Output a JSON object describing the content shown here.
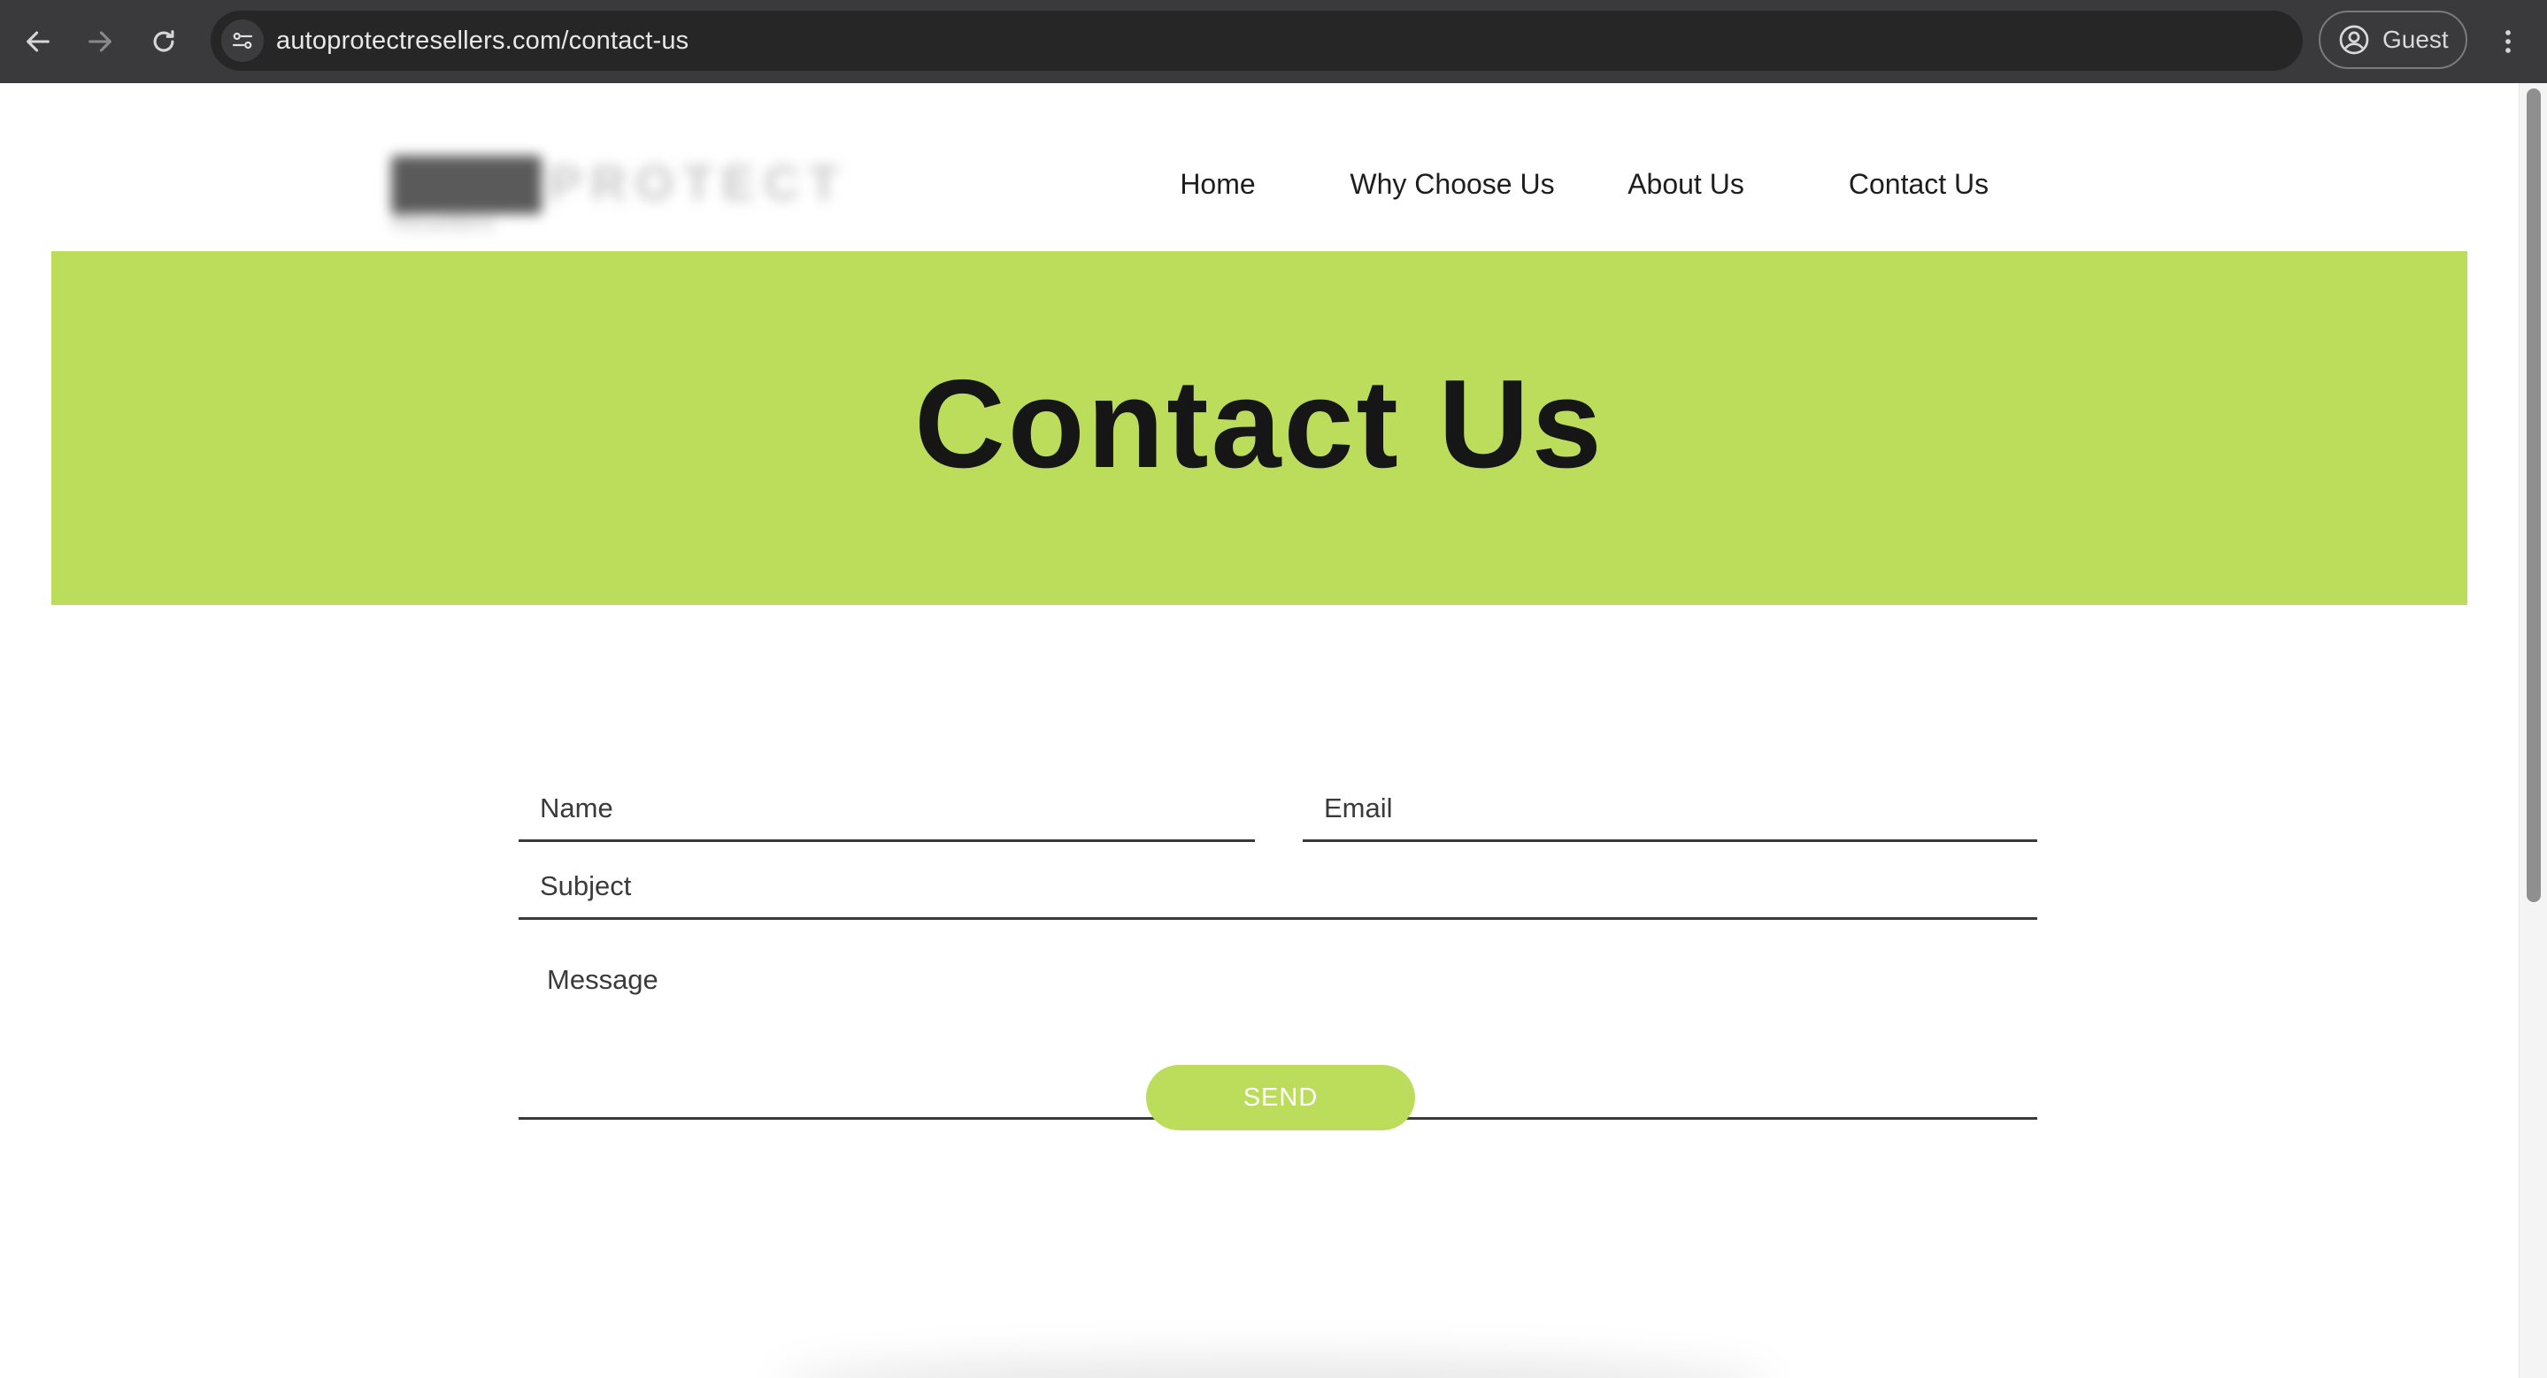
{
  "browser": {
    "url": "autoprotectresellers.com/contact-us",
    "profile_label": "Guest",
    "icons": {
      "back": "arrow-left-icon",
      "forward": "arrow-right-icon",
      "reload": "reload-icon",
      "site_info": "tune-icon",
      "profile": "person-circle-icon",
      "menu": "kebab-menu-icon"
    }
  },
  "site": {
    "logo": {
      "wordmark": "PROTECT",
      "subtitle": "Resellers"
    },
    "nav": [
      "Home",
      "Why Choose Us",
      "About Us",
      "Contact Us"
    ],
    "hero_title": "Contact Us",
    "accent_color": "#bbdd5b",
    "form": {
      "name_placeholder": "Name",
      "email_placeholder": "Email",
      "subject_placeholder": "Subject",
      "message_placeholder": "Message",
      "send_label": "SEND"
    }
  }
}
